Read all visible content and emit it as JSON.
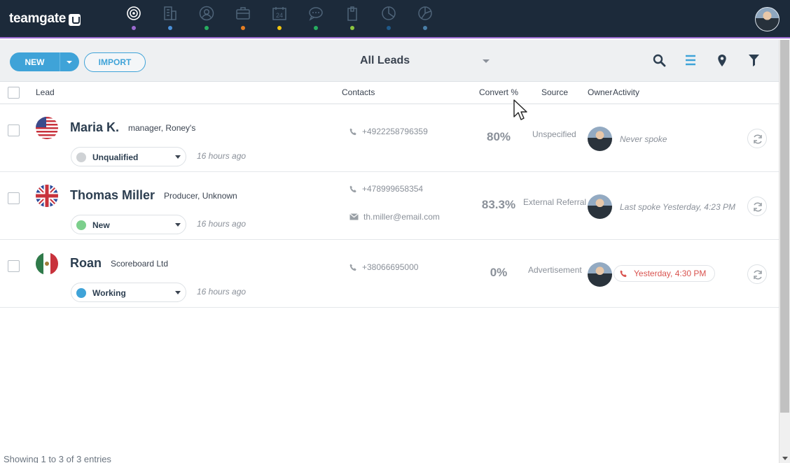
{
  "app": {
    "logo": "teamgate"
  },
  "nav": {
    "items": [
      {
        "icon": "target-icon",
        "dot": "#9b6bd0",
        "active": true
      },
      {
        "icon": "building-icon",
        "dot": "#4a90d9"
      },
      {
        "icon": "contact-icon",
        "dot": "#27ae60"
      },
      {
        "icon": "briefcase-icon",
        "dot": "#e67e22"
      },
      {
        "icon": "calendar-icon",
        "dot": "#f1c40f",
        "text": "24"
      },
      {
        "icon": "chat-icon",
        "dot": "#27ae60"
      },
      {
        "icon": "clipboard-icon",
        "dot": "#8dc63f"
      },
      {
        "icon": "pie-chart-icon",
        "dot": "#1f5a8a"
      },
      {
        "icon": "pie-chart-alt-icon",
        "dot": "#4a7fa8"
      }
    ]
  },
  "toolbar": {
    "new_label": "NEW",
    "import_label": "IMPORT",
    "view_label": "All Leads"
  },
  "table": {
    "columns": {
      "lead": "Lead",
      "contacts": "Contacts",
      "convert": "Convert %",
      "source": "Source",
      "owner": "Owner",
      "activity": "Activity"
    },
    "rows": [
      {
        "name": "Maria K.",
        "subtitle": "manager, Roney's",
        "flag": "us",
        "status": "Unqualified",
        "status_color": "#cfd2d5",
        "ago": "16 hours ago",
        "phone": "+4922258796359",
        "email": "",
        "convert": "80%",
        "source": "Unspecified",
        "activity": "Never spoke"
      },
      {
        "name": "Thomas Miller",
        "subtitle": "Producer, Unknown",
        "flag": "uk",
        "status": "New",
        "status_color": "#7ccf8c",
        "ago": "16 hours ago",
        "phone": "+478999658354",
        "email": "th.miller@email.com",
        "convert": "83.3%",
        "source": "External Referral",
        "activity": "Last spoke Yesterday, 4:23 PM"
      },
      {
        "name": "Roan",
        "subtitle": "Scoreboard Ltd",
        "flag": "mx",
        "status": "Working",
        "status_color": "#3fa3d8",
        "ago": "16 hours ago",
        "phone": "+38066695000",
        "email": "",
        "convert": "0%",
        "source": "Advertisement",
        "activity": "Yesterday, 4:30 PM"
      }
    ]
  },
  "footer": {
    "entries": "Showing 1 to 3 of 3 entries"
  }
}
